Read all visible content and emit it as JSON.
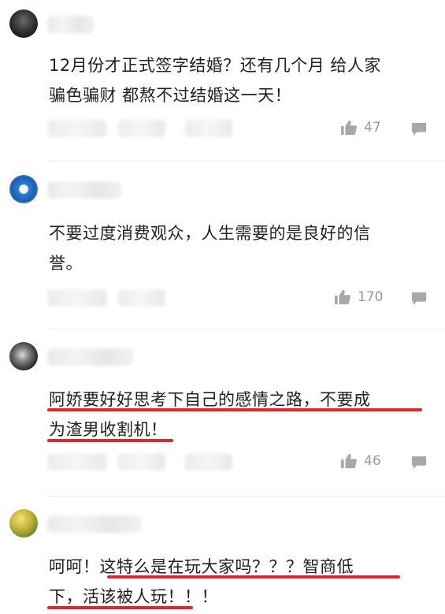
{
  "comments": [
    {
      "text_lines": [
        "12月份才正式签字结婚？还有几个月 给人家",
        "骗色骗财 都熬不过结婚这一天！"
      ],
      "likes": "47",
      "avatar_icon": "avatar-dark-portrait"
    },
    {
      "text_lines": [
        "不要过度消费观众，人生需要的是良好的信",
        "誉。"
      ],
      "likes": "170",
      "avatar_icon": "avatar-blue-flower"
    },
    {
      "text_lines": [
        "阿娇要好好思考下自己的感情之路，不要成",
        "为渣男收割机！"
      ],
      "likes": "46",
      "avatar_icon": "avatar-monochrome"
    },
    {
      "text_lines": [
        "呵呵！这特么是在玩大家吗？？？智商低",
        "下，活该被人玩！！！"
      ],
      "likes": "",
      "avatar_icon": "avatar-yellow-green"
    }
  ],
  "colors": {
    "highlight_underline": "#e2242f",
    "meta_gray": "#9a9a9a"
  },
  "icons": {
    "like": "thumbs-up-icon",
    "reply": "comment-bubble-icon"
  }
}
